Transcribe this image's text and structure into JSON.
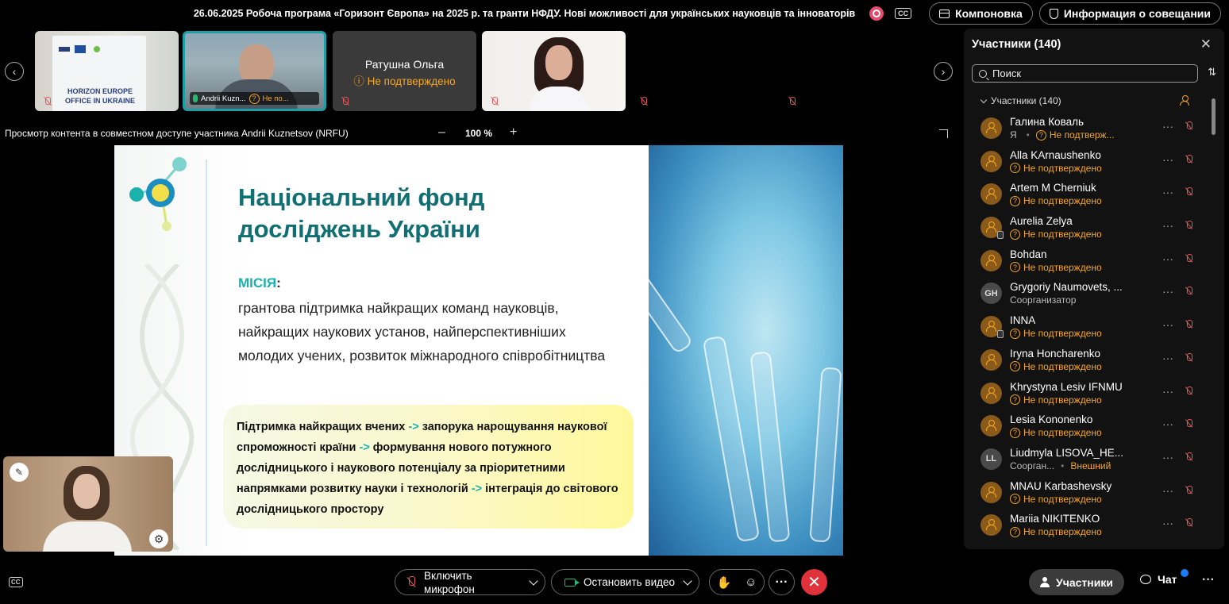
{
  "topbar": {
    "meeting_title": "26.06.2025 Робоча програма «Горизонт Європа» на 2025 р. та гранти НФДУ. Нові можливості для українських науковців та інноваторів",
    "cc_label": "CC",
    "layout_label": "Компоновка",
    "info_label": "Информация о совещании"
  },
  "thumbnails": {
    "t1_banner_text": "HORIZON EUROPE OFFICE IN UKRAINE",
    "t2_name": "Andrii Kuzn...",
    "t2_status": "Не по...",
    "t3_name": "Ратушна Ольга",
    "t3_status": "Не подтверждено"
  },
  "share": {
    "label": "Просмотр контента в совместном доступе участника Andrii Kuznetsov (NRFU)",
    "zoom": "100 %",
    "minus": "–",
    "plus": "+"
  },
  "slide": {
    "title_line1": "Національний фонд",
    "title_line2": "досліджень України",
    "mission_label": "МІСІЯ",
    "mission_colon": ":",
    "mission_line1": "грантова підтримка найкращих команд науковців,",
    "mission_line2": "найкращих наукових установ, найперспективніших",
    "mission_line3": "молодих учених, розвиток міжнародного співробітництва",
    "support_p1": "Підтримка найкращих вчених ",
    "support_p2": " запорука нарощування наукової спроможності країни ",
    "support_p3": " формування нового потужного дослідницького і наукового потенціалу за пріоритетними напрямками розвитку науки і технологій ",
    "support_p4": " інтеграція до світового дослідницького простору",
    "arrow": "->"
  },
  "bottombar": {
    "cc_label": "CC",
    "mic_label": "Включить микрофон",
    "video_label": "Остановить видео",
    "participants_label": "Участники",
    "chat_label": "Чат"
  },
  "panel": {
    "title": "Участники (140)",
    "search_placeholder": "Поиск",
    "section_label": "Участники (140)",
    "participants": [
      {
        "name": "Галина Коваль",
        "me": "Я",
        "status": "Не подтверж...",
        "avatar": "guest"
      },
      {
        "name": "Alla KArnaushenko",
        "status": "Не подтверждено",
        "avatar": "guest"
      },
      {
        "name": "Artem M Cherniuk",
        "status": "Не подтверждено",
        "avatar": "guest"
      },
      {
        "name": "Aurelia Zelya",
        "status": "Не подтверждено",
        "avatar": "guest-device"
      },
      {
        "name": "Bohdan",
        "status": "Не подтверждено",
        "avatar": "guest"
      },
      {
        "name": "Grygoriy Naumovets, ...",
        "status": "Соорганизатор",
        "avatar": "GH"
      },
      {
        "name": "INNA",
        "status": "Не подтверждено",
        "avatar": "guest-device"
      },
      {
        "name": "Iryna Honcharenko",
        "status": "Не подтверждено",
        "avatar": "guest"
      },
      {
        "name": "Khrystyna Lesiv IFNMU",
        "status": "Не подтверждено",
        "avatar": "guest"
      },
      {
        "name": "Lesia Kononenko",
        "status": "Не подтверждено",
        "avatar": "guest"
      },
      {
        "name": "Liudmyla LISOVA_HE...",
        "status": "Соорган...",
        "extra": "Внешний",
        "avatar": "LL"
      },
      {
        "name": "MNAU Karbashevsky",
        "status": "Не подтверждено",
        "avatar": "guest"
      },
      {
        "name": "Mariia NIKITENKO",
        "status": "Не подтверждено",
        "avatar": "guest"
      }
    ]
  },
  "colors": {
    "accent_teal": "#1d9fa8",
    "warning_orange": "#f5a623",
    "end_call_red": "#e0323b",
    "slide_title": "#116f73"
  }
}
